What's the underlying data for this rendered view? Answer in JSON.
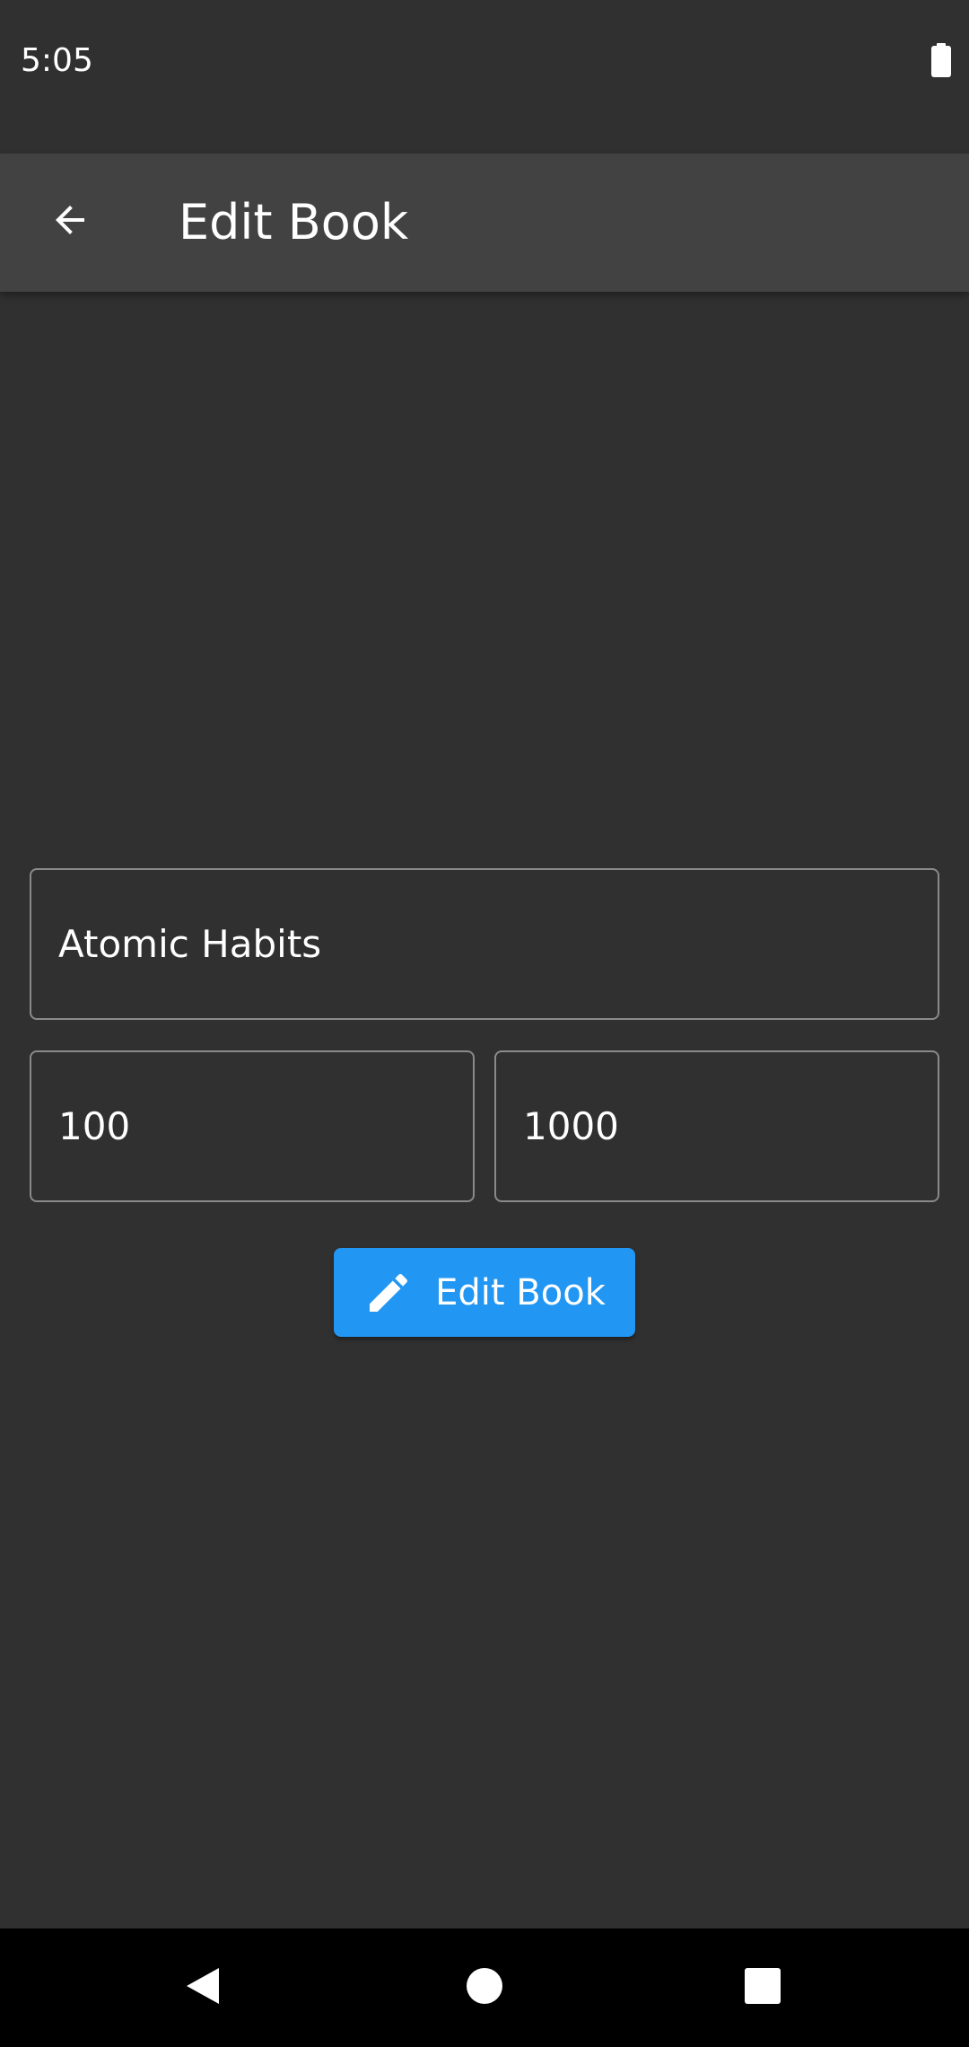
{
  "status_bar": {
    "time": "5:05",
    "battery_icon": "battery-full-icon"
  },
  "app_bar": {
    "back_icon": "arrow-back-icon",
    "title": "Edit Book"
  },
  "form": {
    "title_value": "Atomic Habits",
    "current_page_value": "100",
    "total_pages_value": "1000",
    "submit_label": "Edit Book",
    "submit_icon": "pencil-icon",
    "accent_color": "#2196f3"
  },
  "nav_bar": {
    "back_icon": "nav-back-icon",
    "home_icon": "nav-home-icon",
    "recents_icon": "nav-recents-icon"
  }
}
